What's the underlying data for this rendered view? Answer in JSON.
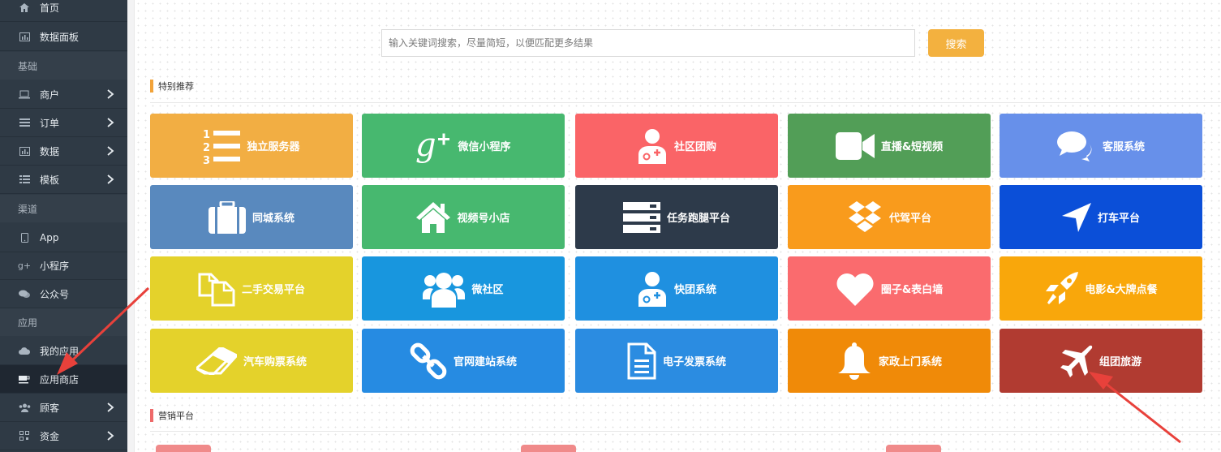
{
  "sidebar": {
    "items": {
      "home": "首页",
      "dashboard": "数据面板",
      "merchant": "商户",
      "orders": "订单",
      "data": "数据",
      "template": "模板",
      "app": "App",
      "miniprogram": "小程序",
      "official": "公众号",
      "myapps": "我的应用",
      "appstore": "应用商店",
      "customers": "顾客",
      "funds": "资金"
    },
    "groups": {
      "basic": "基础",
      "channel": "渠道",
      "application": "应用"
    }
  },
  "search": {
    "placeholder": "输入关键词搜索，尽量简短，以便匹配更多结果",
    "button": "搜索"
  },
  "sections": {
    "featured": "特别推荐",
    "marketing": "营销平台"
  },
  "tiles": [
    {
      "label": "独立服务器",
      "icon": "list-ol-icon",
      "color": "#f2ae43"
    },
    {
      "label": "微信小程序",
      "icon": "google-plus-icon",
      "color": "#47b86f"
    },
    {
      "label": "社区团购",
      "icon": "user-md-icon",
      "color": "#fa6467"
    },
    {
      "label": "直播&短视频",
      "icon": "video-camera-icon",
      "color": "#529e57"
    },
    {
      "label": "客服系统",
      "icon": "comments-icon",
      "color": "#6790ea"
    },
    {
      "label": "同城系统",
      "icon": "suitcase-icon",
      "color": "#5989be"
    },
    {
      "label": "视频号小店",
      "icon": "home-icon",
      "color": "#47b86f"
    },
    {
      "label": "任务跑腿平台",
      "icon": "server-icon",
      "color": "#2d3a4a"
    },
    {
      "label": "代驾平台",
      "icon": "dropbox-icon",
      "color": "#f99b1c"
    },
    {
      "label": "打车平台",
      "icon": "location-arrow-icon",
      "color": "#0b4fd8"
    },
    {
      "label": "二手交易平台",
      "icon": "copy-icon",
      "color": "#e4d22b"
    },
    {
      "label": "微社区",
      "icon": "users-icon",
      "color": "#1896de"
    },
    {
      "label": "快团系统",
      "icon": "user-md-icon",
      "color": "#1f90e0"
    },
    {
      "label": "圈子&表白墙",
      "icon": "heart-icon",
      "color": "#fa6b6e"
    },
    {
      "label": "电影&大牌点餐",
      "icon": "rocket-icon",
      "color": "#f9a70b"
    },
    {
      "label": "汽车购票系统",
      "icon": "eraser-icon",
      "color": "#e4d22b"
    },
    {
      "label": "官网建站系统",
      "icon": "link-icon",
      "color": "#268be2"
    },
    {
      "label": "电子发票系统",
      "icon": "file-text-icon",
      "color": "#2b8ce1"
    },
    {
      "label": "家政上门系统",
      "icon": "bell-icon",
      "color": "#f08a08"
    },
    {
      "label": "组团旅游",
      "icon": "plane-icon",
      "color": "#b13b31"
    }
  ],
  "colors": {
    "sidebar_bg": "#2f3a45",
    "search_button": "#f3b13f",
    "featured_bar": "#f2a33a",
    "marketing_bar": "#ee6a6a",
    "arrow": "#e8413b"
  }
}
